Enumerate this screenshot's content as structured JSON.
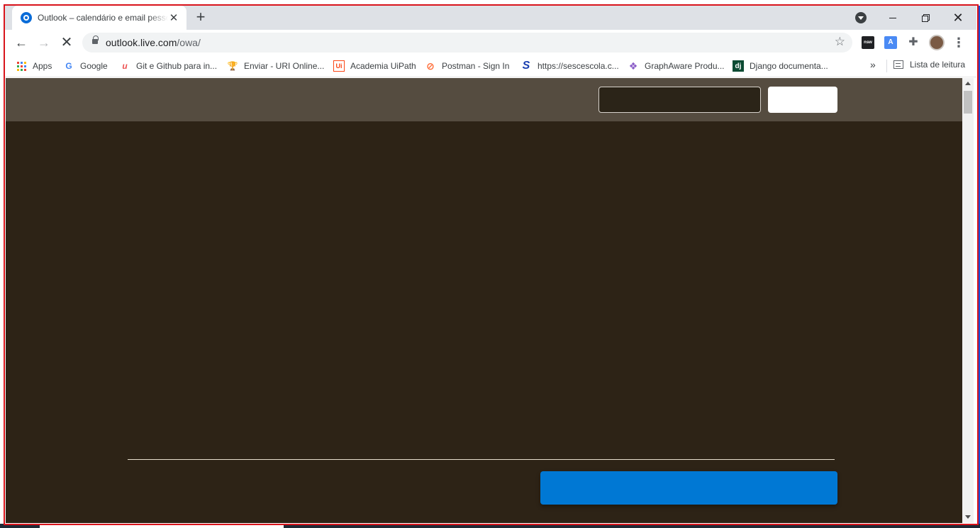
{
  "browser": {
    "tab": {
      "title": "Outlook – calendário e email pessoal",
      "close_symbol": "✕"
    },
    "new_tab_symbol": "+",
    "window_controls": {
      "close_symbol": "✕"
    },
    "nav": {
      "back_symbol": "←",
      "forward_symbol": "→",
      "stop_symbol": "✕"
    },
    "address": {
      "host": "outlook.live.com",
      "path": "/owa/"
    },
    "bookmark_star_symbol": "☆",
    "extensions": {
      "nsw_label": "nsw",
      "translate_label": "A",
      "puzzle_symbol": "✚",
      "menu_symbol": "⋮"
    }
  },
  "bookmarks": {
    "items": [
      {
        "label": "Apps",
        "icon": "apps-grid-icon"
      },
      {
        "label": "Google",
        "icon": "google-icon",
        "glyph": "G",
        "color": "#4285f4"
      },
      {
        "label": "Git e Github para in...",
        "icon": "udemy-icon",
        "glyph": "u",
        "color": "#ec5252"
      },
      {
        "label": "Enviar - URI Online...",
        "icon": "trophy-icon",
        "glyph": "🏆",
        "color": "#e0a020"
      },
      {
        "label": "Academia UiPath",
        "icon": "uipath-icon",
        "glyph": "Ui",
        "color": "#fa4616"
      },
      {
        "label": "Postman - Sign In",
        "icon": "postman-icon",
        "glyph": "⊘",
        "color": "#ff6c37"
      },
      {
        "label": "https://sescescola.c...",
        "icon": "sesc-icon",
        "glyph": "S",
        "color": "#1a3fb0"
      },
      {
        "label": "GraphAware Produ...",
        "icon": "graphaware-icon",
        "glyph": "❖",
        "color": "#8a5cc7"
      },
      {
        "label": "Django documenta...",
        "icon": "django-icon",
        "glyph": "dj",
        "color": "#0c4b33"
      }
    ],
    "overflow_symbol": "»",
    "reading_list_label": "Lista de leitura"
  },
  "colors": {
    "page_background": "#2d2316",
    "header_background": "#554c40",
    "primary_button": "#0078d4",
    "divider": "#e9e0cf"
  }
}
